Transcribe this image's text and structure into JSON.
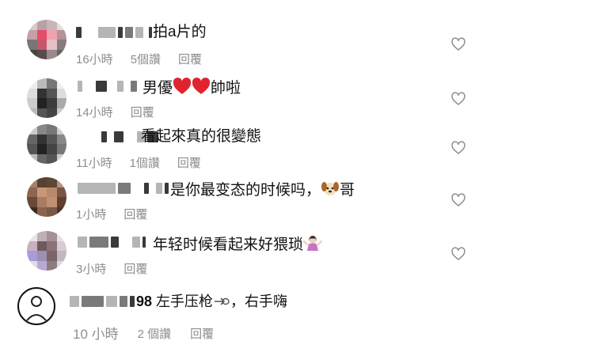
{
  "comments": [
    {
      "text": "拍a片的",
      "time": "16小時",
      "likes": "5個讚",
      "reply": "回覆",
      "heart": true
    },
    {
      "text_before": "男優",
      "text_after": "帥啦",
      "time": "14小時",
      "likes": "",
      "reply": "回覆",
      "heart": true
    },
    {
      "text": "看起來真的很變態",
      "time": "11小時",
      "likes": "1個讚",
      "reply": "回覆",
      "heart": true
    },
    {
      "text_before": "是你最变态的时候吗，",
      "text_after": "哥",
      "time": "1小時",
      "likes": "",
      "reply": "回覆",
      "heart": true
    },
    {
      "text": "年轻时候看起来好猥琐",
      "time": "3小時",
      "likes": "",
      "reply": "回覆",
      "heart": true
    },
    {
      "username_tail": "98",
      "text_before": "左手压枪",
      "text_after": "，右手嗨",
      "time": "10 小時",
      "likes": "2 個讚",
      "reply": "回覆",
      "heart": false
    }
  ],
  "icons": {
    "like": "heart-outline-icon",
    "love": "red-heart-icon",
    "dog": "dog-face-icon",
    "shrug": "woman-shrugging-icon",
    "point": "pointing-hand-icon"
  },
  "colors": {
    "meta": "#8e8e8e",
    "heart_outline": "#8e8e8e",
    "red_heart": "#e0242f"
  }
}
